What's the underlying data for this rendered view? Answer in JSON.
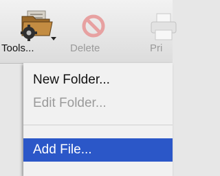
{
  "toolbar": {
    "tools_label": "Tools...",
    "delete_label": "Delete",
    "print_label": "Pri"
  },
  "menu": {
    "new_folder": "New Folder...",
    "edit_folder": "Edit Folder...",
    "add_file": "Add File..."
  },
  "icons": {
    "tools": "tools-folder-gear-icon",
    "delete": "delete-prohibited-icon",
    "print": "printer-icon"
  },
  "colors": {
    "selection": "#2b57c8",
    "disabled_text": "#9a9a9a",
    "delete_icon": "#e7a1a1"
  }
}
